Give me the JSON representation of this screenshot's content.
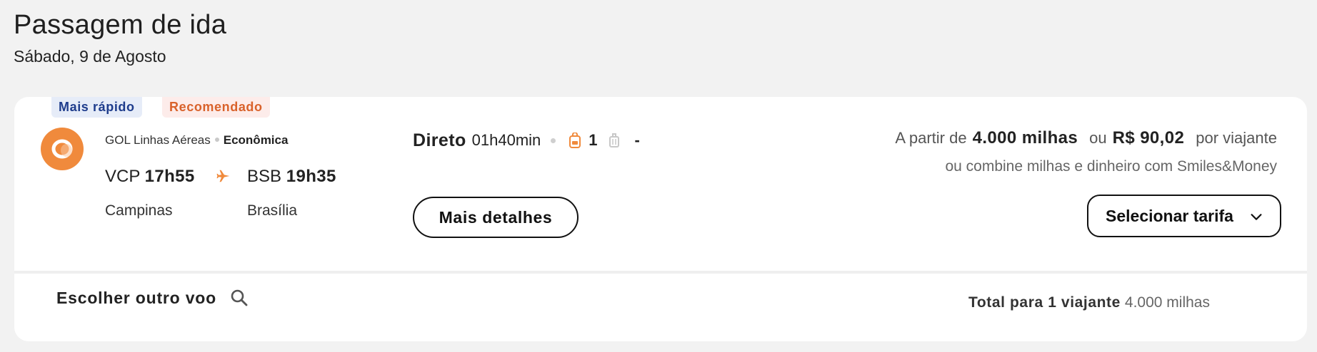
{
  "header": {
    "title": "Passagem de ida",
    "date": "Sábado, 9 de Agosto"
  },
  "flight": {
    "badges": {
      "fastest": "Mais rápido",
      "recommended": "Recomendado"
    },
    "airline": "GOL Linhas Aéreas",
    "cabin": "Econômica",
    "departure": {
      "code": "VCP",
      "time": "17h55",
      "city": "Campinas"
    },
    "arrival": {
      "code": "BSB",
      "time": "19h35",
      "city": "Brasília"
    },
    "stops": "Direto",
    "duration": "01h40min",
    "carry_on_count": "1",
    "checked_bag": "-",
    "details_label": "Mais detalhes",
    "price": {
      "from_label": "A partir de",
      "miles": "4.000 milhas",
      "or_label": "ou",
      "money": "R$ 90,02",
      "per_label": "por viajante",
      "combine_text": "ou combine milhas e dinheiro com Smiles&Money"
    },
    "select_label": "Selecionar tarifa"
  },
  "footer": {
    "other_flight_label": "Escolher outro voo",
    "total_label": "Total para 1 viajante",
    "total_value": "4.000 milhas"
  },
  "colors": {
    "accent": "#f08a3c",
    "badge_fast_bg": "#e6ecf8",
    "badge_fast_text": "#1e3c8c",
    "badge_rec_bg": "#fdecea",
    "badge_rec_text": "#d9622b",
    "background": "#f2f2f2"
  },
  "icons": [
    "gol-logo-icon",
    "plane-icon",
    "backpack-icon",
    "suitcase-icon",
    "chevron-down-icon",
    "search-icon"
  ]
}
